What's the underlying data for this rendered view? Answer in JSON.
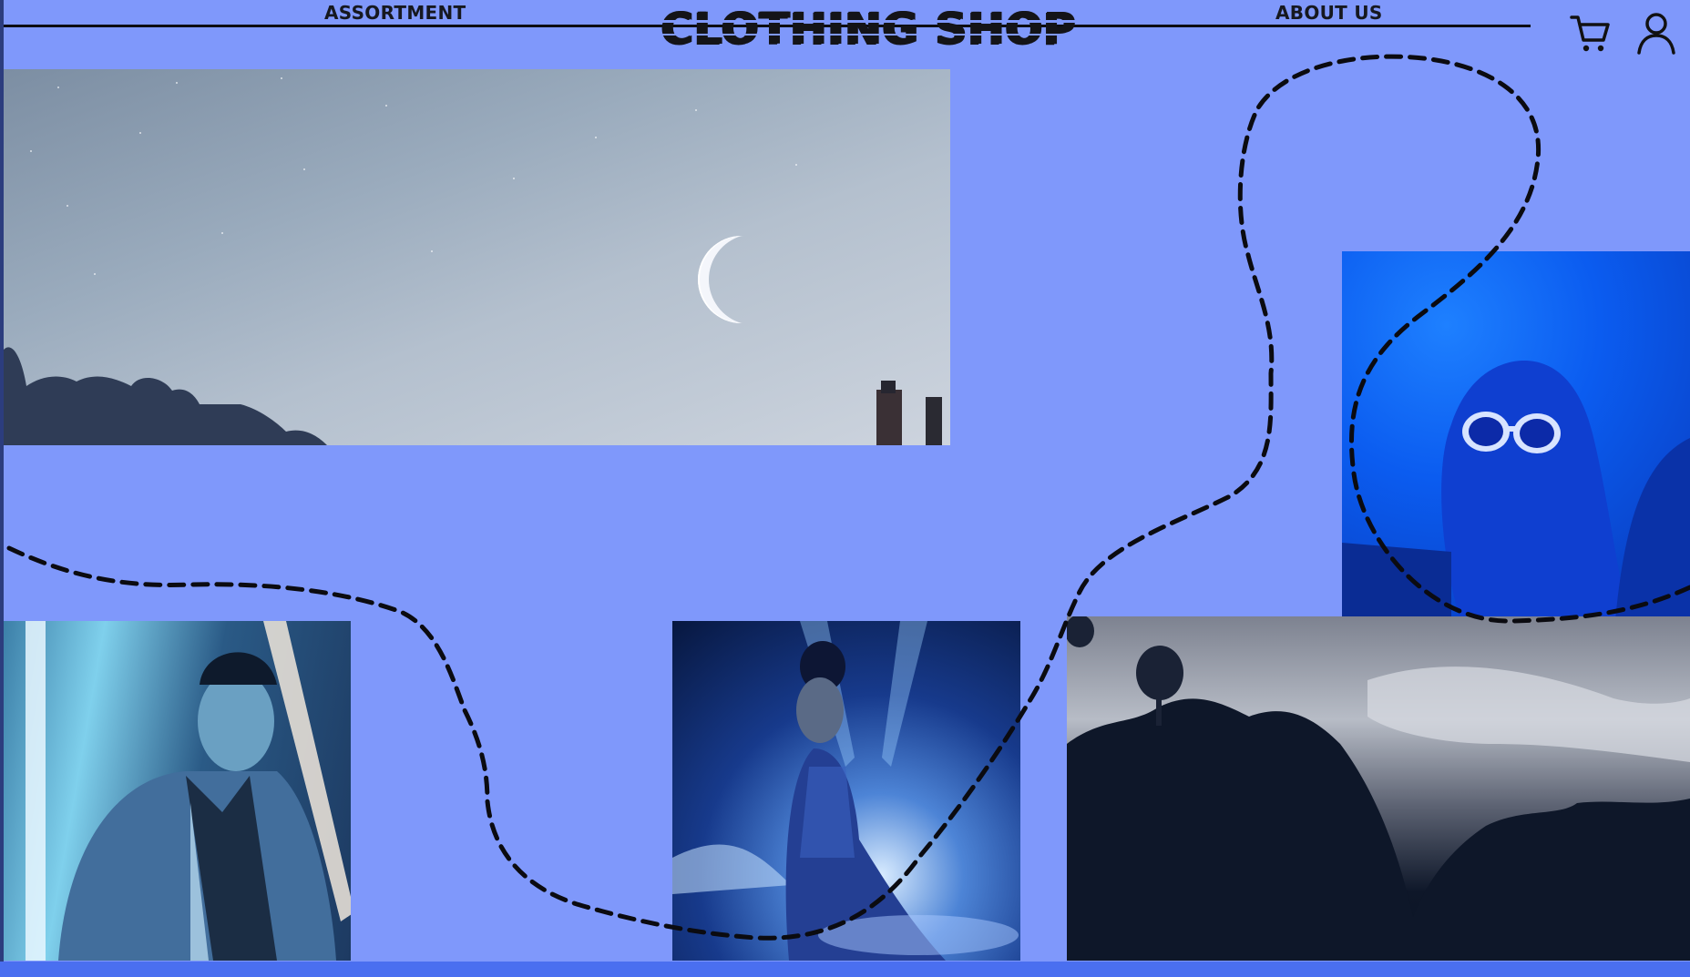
{
  "header": {
    "logo": "CLOTHING SHOP",
    "nav": {
      "assortment": "ASSORTMENT",
      "about_us": "ABOUT US"
    },
    "icons": {
      "cart": "cart-icon",
      "user": "user-icon"
    }
  },
  "gallery": {
    "images": [
      {
        "name": "moon-sky-photo",
        "subject": "half moon over a night sky with silhouetted hills and figures"
      },
      {
        "name": "ghost-sunglasses-photo",
        "subject": "blue sheet ghost wearing white sunglasses"
      },
      {
        "name": "man-jacket-photo",
        "subject": "man in quilted bomber jacket in blue light"
      },
      {
        "name": "woman-sequin-photo",
        "subject": "woman in sequined blue dress seated in light beams"
      },
      {
        "name": "forest-landscape-photo",
        "subject": "dark tree silhouettes under grey clouds"
      }
    ]
  },
  "colors": {
    "background": "#7f98fb",
    "text": "#16181f",
    "accent_bar": "#4a6ff0"
  }
}
